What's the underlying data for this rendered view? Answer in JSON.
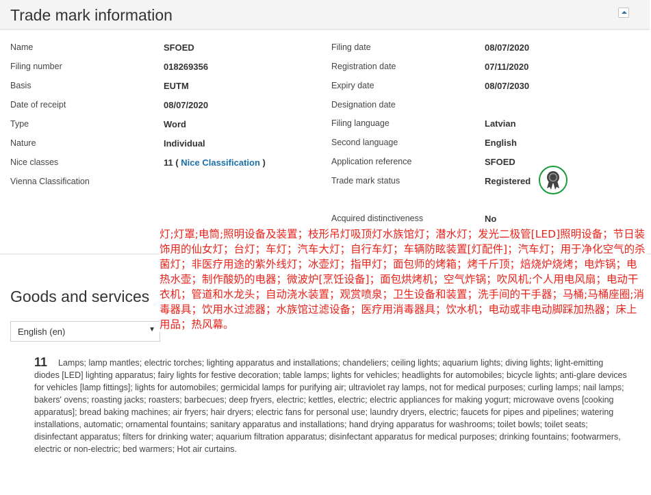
{
  "header": {
    "title": "Trade mark information"
  },
  "details_left": [
    {
      "label": "Name",
      "value": "SFOED"
    },
    {
      "label": "Filing number",
      "value": "018269356"
    },
    {
      "label": "Basis",
      "value": "EUTM"
    },
    {
      "label": "Date of receipt",
      "value": "08/07/2020"
    },
    {
      "label": "Type",
      "value": "Word"
    },
    {
      "label": "Nature",
      "value": "Individual"
    },
    {
      "label": "Nice classes",
      "value": "11 ( ",
      "link": "Nice Classification",
      "suffix": " )"
    },
    {
      "label": "Vienna Classification",
      "value": ""
    }
  ],
  "details_right": [
    {
      "label": "Filing date",
      "value": "08/07/2020"
    },
    {
      "label": "Registration date",
      "value": "07/11/2020"
    },
    {
      "label": "Expiry date",
      "value": "08/07/2030"
    },
    {
      "label": "Designation date",
      "value": ""
    },
    {
      "label": "Filing language",
      "value": "Latvian"
    },
    {
      "label": "Second language",
      "value": "English"
    },
    {
      "label": "Application reference",
      "value": "SFOED"
    },
    {
      "label": "Trade mark status",
      "value": "Registered"
    },
    {
      "label": "Acquired distinctiveness",
      "value": "No"
    }
  ],
  "goods": {
    "title": "Goods and services",
    "language_select": "English (en)",
    "class_number": "11",
    "text": "Lamps; lamp mantles; electric torches; lighting apparatus and installations; chandeliers; ceiling lights; aquarium lights; diving lights; light-emitting diodes [LED] lighting apparatus; fairy lights for festive decoration; table lamps; lights for vehicles; headlights for automobiles; bicycle lights; anti-glare devices for vehicles [lamp fittings]; lights for automobiles; germicidal lamps for purifying air; ultraviolet ray lamps, not for medical purposes; curling lamps; nail lamps; bakers' ovens; roasting jacks; roasters; barbecues; deep fryers, electric; kettles, electric; electric appliances for making yogurt; microwave ovens [cooking apparatus]; bread baking machines; air fryers; hair dryers; electric fans for personal use; laundry dryers, electric; faucets for pipes and pipelines; watering installations, automatic; ornamental fountains; sanitary apparatus and installations; hand drying apparatus for washrooms; toilet bowls; toilet seats; disinfectant apparatus; filters for drinking water; aquarium filtration apparatus; disinfectant apparatus for medical purposes; drinking fountains; footwarmers, electric or non-electric; bed warmers; Hot air curtains."
  },
  "overlay_text": "灯;灯罩;电筒;照明设备及装置；枝形吊灯吸顶灯水族馆灯；潜水灯；发光二极管[LED]照明设备；节日装饰用的仙女灯；台灯；车灯；汽车大灯；自行车灯；车辆防眩装置[灯配件]；汽车灯；用于净化空气的杀菌灯；非医疗用途的紫外线灯；冰壶灯；指甲灯；面包师的烤箱；烤千斤顶；焙烧炉烧烤；电炸锅；电热水壶；制作酸奶的电器；微波炉[烹饪设备]；面包烘烤机；空气炸锅；吹风机;个人用电风扇；电动干衣机；管道和水龙头；自动浇水装置；观赏喷泉；卫生设备和装置；洗手间的干手器；马桶;马桶座圈;消毒器具；饮用水过滤器；水族馆过滤设备；医疗用消毒器具；饮水机；电动或非电动脚踩加热器；床上用品；热风幕。",
  "colors": {
    "link": "#1a6fa8",
    "overlay": "#e8231b",
    "status_green": "#1b9a3b"
  }
}
